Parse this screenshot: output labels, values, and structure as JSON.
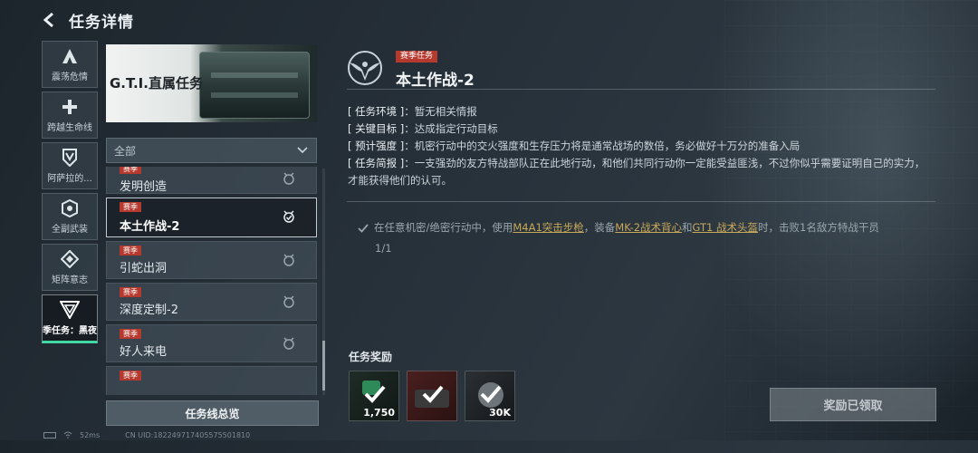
{
  "header": {
    "title": "任务详情"
  },
  "rail": {
    "items": [
      {
        "label": "震荡危情",
        "icon": "a-logo-icon"
      },
      {
        "label": "跨越生命线",
        "icon": "cross-icon"
      },
      {
        "label": "阿萨拉的...",
        "icon": "shield-v-icon"
      },
      {
        "label": "全副武装",
        "icon": "hex-badge-icon"
      },
      {
        "label": "矩阵意志",
        "icon": "diamond-icon"
      },
      {
        "label": "季任务：黑夜",
        "icon": "triangle-badge-icon"
      }
    ]
  },
  "banner": {
    "title": "G.T.I.直属任务"
  },
  "filter": {
    "label": "全部"
  },
  "missions": [
    {
      "tag": "赛季",
      "name": "发明创造"
    },
    {
      "tag": "赛季",
      "name": "本土作战-2"
    },
    {
      "tag": "赛季",
      "name": "引蛇出洞"
    },
    {
      "tag": "赛季",
      "name": "深度定制-2"
    },
    {
      "tag": "赛季",
      "name": "好人来电"
    },
    {
      "tag": "赛季",
      "name": ""
    }
  ],
  "overview_button": "任务线总览",
  "status": {
    "latency": "52ms",
    "uid": "CN UID:18224971740557550181​0"
  },
  "detail": {
    "tag": "赛季任务",
    "title": "本土作战-2",
    "env_key": "[ 任务环境 ]",
    "env_val": "：暂无相关情报",
    "target_key": "[ 关键目标 ]",
    "target_val": "：达成指定行动目标",
    "intensity_key": "[ 预计强度 ]",
    "intensity_val": "：机密行动中的交火强度和生存压力将是通常战场的数倍，务必做好十万分的准备入局",
    "brief_key": "[ 任务简报 ]",
    "brief_val": "：一支强劲的友方特战部队正在此地行动，和他们共同行动你一定能受益匪浅，不过你似乎需要证明自己的实力，才能获得他们的认可。",
    "obj_1": "在任意机密/绝密行动中，使用",
    "obj_hl1": "M4A1突击步枪",
    "obj_2": "，装备",
    "obj_hl2": "MK-2战术背心",
    "obj_3": "和",
    "obj_hl3": "GT1 战术头盔",
    "obj_4": "时，击败1名敌方特战干员",
    "progress": "1/1"
  },
  "rewards": {
    "label": "任务奖励",
    "items": [
      {
        "count": "1,750"
      },
      {
        "count": ""
      },
      {
        "count": "30K"
      }
    ]
  },
  "claimed_button": "奖励已领取",
  "colors": {
    "accent": "#3fd7a2",
    "season_tag": "#b6392e",
    "highlight": "#c8a85a"
  }
}
